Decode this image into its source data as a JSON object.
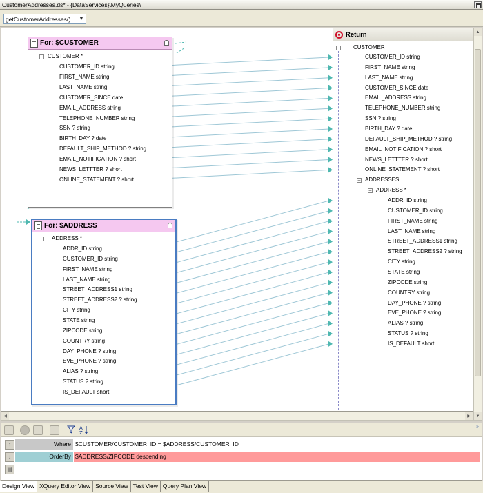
{
  "window": {
    "title": "CustomerAddresses.ds* - {DataServices}\\MyQueries\\"
  },
  "toolbar": {
    "function_select": "getCustomerAddresses()"
  },
  "customer_box": {
    "title": "For: $CUSTOMER",
    "root": "CUSTOMER *",
    "fields": [
      "CUSTOMER_ID string",
      "FIRST_NAME string",
      "LAST_NAME string",
      "CUSTOMER_SINCE date",
      "EMAIL_ADDRESS string",
      "TELEPHONE_NUMBER string",
      "SSN ? string",
      "BIRTH_DAY ? date",
      "DEFAULT_SHIP_METHOD ? string",
      "EMAIL_NOTIFICATION ? short",
      "NEWS_LETTTER ? short",
      "ONLINE_STATEMENT ? short"
    ]
  },
  "address_box": {
    "title": "For: $ADDRESS",
    "root": "ADDRESS *",
    "fields": [
      "ADDR_ID string",
      "CUSTOMER_ID string",
      "FIRST_NAME string",
      "LAST_NAME string",
      "STREET_ADDRESS1 string",
      "STREET_ADDRESS2 ? string",
      "CITY string",
      "STATE string",
      "ZIPCODE string",
      "COUNTRY string",
      "DAY_PHONE ? string",
      "EVE_PHONE ? string",
      "ALIAS ? string",
      "STATUS ? string",
      "IS_DEFAULT short"
    ]
  },
  "return_panel": {
    "title": "Return",
    "root": "CUSTOMER",
    "customer_fields": [
      "CUSTOMER_ID string",
      "FIRST_NAME string",
      "LAST_NAME string",
      "CUSTOMER_SINCE date",
      "EMAIL_ADDRESS string",
      "TELEPHONE_NUMBER string",
      "SSN ? string",
      "BIRTH_DAY ? date",
      "DEFAULT_SHIP_METHOD ? string",
      "EMAIL_NOTIFICATION ? short",
      "NEWS_LETTTER ? short",
      "ONLINE_STATEMENT ? short"
    ],
    "addresses_node": "ADDRESSES",
    "address_node": "ADDRESS *",
    "address_fields": [
      "ADDR_ID string",
      "CUSTOMER_ID string",
      "FIRST_NAME string",
      "LAST_NAME string",
      "STREET_ADDRESS1 string",
      "STREET_ADDRESS2 ? string",
      "CITY string",
      "STATE string",
      "ZIPCODE string",
      "COUNTRY string",
      "DAY_PHONE ? string",
      "EVE_PHONE ? string",
      "ALIAS ? string",
      "STATUS ? string",
      "IS_DEFAULT short"
    ]
  },
  "clauses": {
    "where_label": "Where",
    "where_value": "$CUSTOMER/CUSTOMER_ID = $ADDRESS/CUSTOMER_ID",
    "orderby_label": "OrderBy",
    "orderby_value": "$ADDRESS/ZIPCODE descending"
  },
  "tabs": [
    "Design View",
    "XQuery Editor View",
    "Source View",
    "Test View",
    "Query Plan View"
  ],
  "colors": {
    "box_header": "#f5c8f0",
    "link_line": "#9ec7d6",
    "link_arrow": "#4fb8b0",
    "orderby_row": "#ff9a9a",
    "where_header": "#c8c8c8",
    "orderby_header": "#9fcfd4",
    "selected_border": "#4a7cc2"
  }
}
